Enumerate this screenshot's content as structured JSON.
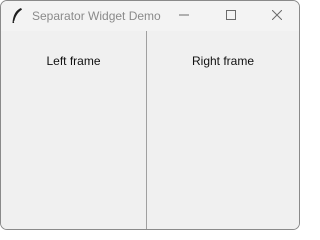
{
  "window": {
    "title": "Separator Widget Demo",
    "app_icon": "tk-feather-icon",
    "controls": {
      "minimize_icon": "minimize-icon",
      "maximize_icon": "maximize-icon",
      "close_icon": "close-icon"
    }
  },
  "frames": {
    "left": {
      "label": "Left frame"
    },
    "right": {
      "label": "Right frame"
    }
  },
  "colors": {
    "window_bg": "#f0f0f0",
    "titlebar_bg": "#f3f3f3",
    "title_text": "#8a8a8a",
    "separator": "#a0a0a0"
  }
}
